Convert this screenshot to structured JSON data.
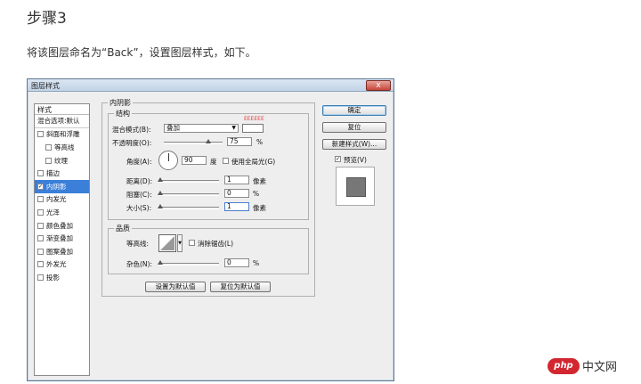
{
  "article": {
    "title": "步骤3",
    "instruction": "将该图层命名为“Back”，设置图层样式，如下。"
  },
  "dialog": {
    "title": "图层样式",
    "close_label": "x",
    "styles_header": "样式",
    "style_items": [
      {
        "label": "混合选项:默认",
        "checked": null
      },
      {
        "label": "斜面和浮雕",
        "checked": false
      },
      {
        "label": "等高线",
        "checked": false
      },
      {
        "label": "纹理",
        "checked": false
      },
      {
        "label": "描边",
        "checked": false
      },
      {
        "label": "内阴影",
        "checked": true
      },
      {
        "label": "内发光",
        "checked": false
      },
      {
        "label": "光泽",
        "checked": false
      },
      {
        "label": "颜色叠加",
        "checked": false
      },
      {
        "label": "渐变叠加",
        "checked": false
      },
      {
        "label": "图案叠加",
        "checked": false
      },
      {
        "label": "外发光",
        "checked": false
      },
      {
        "label": "投影",
        "checked": false
      }
    ],
    "group_title": "内阴影",
    "structure": {
      "title": "结构",
      "blend_mode_label": "混合模式(B):",
      "blend_mode_value": "叠加",
      "color_hex": "EEEEEE",
      "opacity_label": "不透明度(O):",
      "opacity_value": "75",
      "opacity_fraction": 0.75,
      "percent": "%",
      "angle_label": "角度(A):",
      "angle_value": "90",
      "angle_unit": "度",
      "global_light_label": "使用全局光(G)",
      "distance_label": "距离(D):",
      "distance_value": "1",
      "distance_unit": "像素",
      "choke_label": "阻塞(C):",
      "choke_value": "0",
      "size_label": "大小(S):",
      "size_value": "1",
      "size_unit": "像素"
    },
    "quality": {
      "title": "品质",
      "contour_label": "等高线:",
      "antialias_label": "消除锯齿(L)",
      "noise_label": "杂色(N):",
      "noise_value": "0"
    },
    "make_default_label": "设置为默认值",
    "reset_default_label": "复位为默认值",
    "ok_label": "确定",
    "cancel_label": "复位",
    "new_style_label": "新建样式(W)...",
    "preview_label": "预览(V)",
    "colors": {
      "selected_row": "#3b7fd9",
      "titlebar": "#c2d3e6",
      "close": "#c6463a"
    }
  },
  "watermark": {
    "logo_text": "php",
    "site_text": "中文网"
  }
}
